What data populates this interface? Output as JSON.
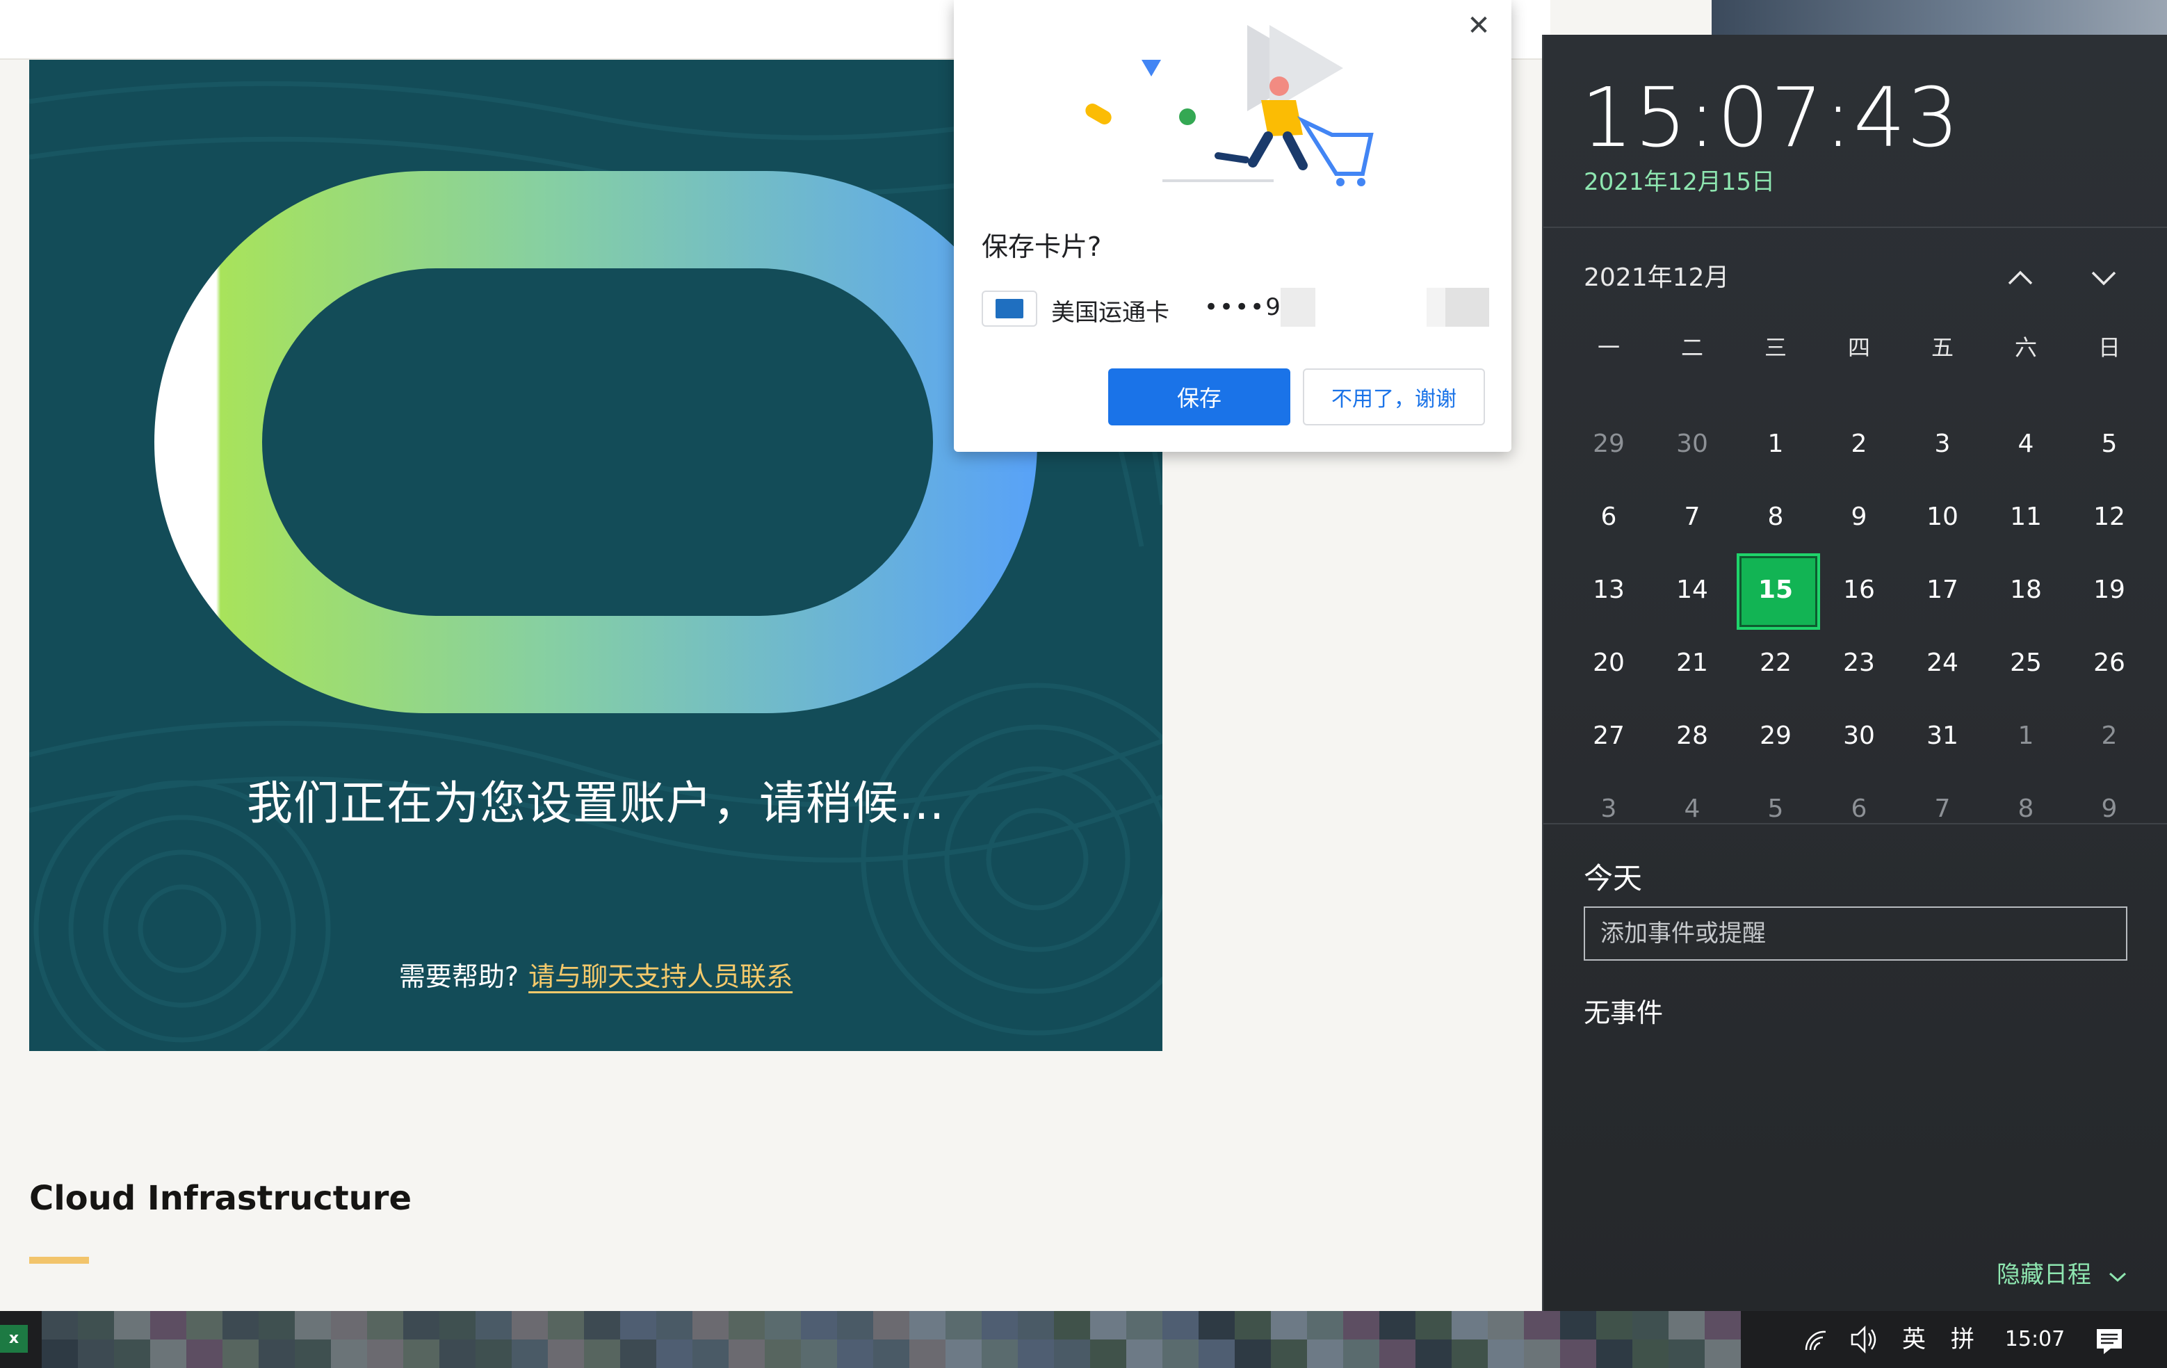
{
  "page": {
    "setup_message": "我们正在为您设置账户，请稍候...",
    "help_prefix": "需要帮助?",
    "help_link": "请与聊天支持人员联系",
    "section_title": "Cloud Infrastructure"
  },
  "dialog": {
    "title": "保存卡片?",
    "card_name": "美国运通卡",
    "card_masked": "••••98",
    "save_label": "保存",
    "decline_label": "不用了，谢谢",
    "close_label": "✕",
    "accent": "#1a73e8"
  },
  "flyout": {
    "time": "15:07:43",
    "date": "2021年12月15日",
    "month_label": "2021年12月",
    "weekdays": [
      "一",
      "二",
      "三",
      "四",
      "五",
      "六",
      "日"
    ],
    "days": [
      {
        "d": "29",
        "m": true
      },
      {
        "d": "30",
        "m": true
      },
      {
        "d": "1"
      },
      {
        "d": "2"
      },
      {
        "d": "3"
      },
      {
        "d": "4"
      },
      {
        "d": "5"
      },
      {
        "d": "6"
      },
      {
        "d": "7"
      },
      {
        "d": "8"
      },
      {
        "d": "9"
      },
      {
        "d": "10"
      },
      {
        "d": "11"
      },
      {
        "d": "12"
      },
      {
        "d": "13"
      },
      {
        "d": "14"
      },
      {
        "d": "15",
        "today": true
      },
      {
        "d": "16"
      },
      {
        "d": "17"
      },
      {
        "d": "18"
      },
      {
        "d": "19"
      },
      {
        "d": "20"
      },
      {
        "d": "21"
      },
      {
        "d": "22"
      },
      {
        "d": "23"
      },
      {
        "d": "24"
      },
      {
        "d": "25"
      },
      {
        "d": "26"
      },
      {
        "d": "27"
      },
      {
        "d": "28"
      },
      {
        "d": "29"
      },
      {
        "d": "30"
      },
      {
        "d": "31"
      },
      {
        "d": "1",
        "m": true
      },
      {
        "d": "2",
        "m": true
      },
      {
        "d": "3",
        "m": true
      },
      {
        "d": "4",
        "m": true
      },
      {
        "d": "5",
        "m": true
      },
      {
        "d": "6",
        "m": true
      },
      {
        "d": "7",
        "m": true
      },
      {
        "d": "8",
        "m": true
      },
      {
        "d": "9",
        "m": true
      }
    ],
    "today_heading": "今天",
    "event_placeholder": "添加事件或提醒",
    "no_events": "无事件",
    "hide_agenda": "隐藏日程",
    "accent": "#12b454"
  },
  "taskbar": {
    "ime_lang": "英",
    "ime_mode": "拼",
    "time": "15:07",
    "icons": [
      "excel-icon",
      "network-icon",
      "volume-icon",
      "notification-icon"
    ]
  }
}
